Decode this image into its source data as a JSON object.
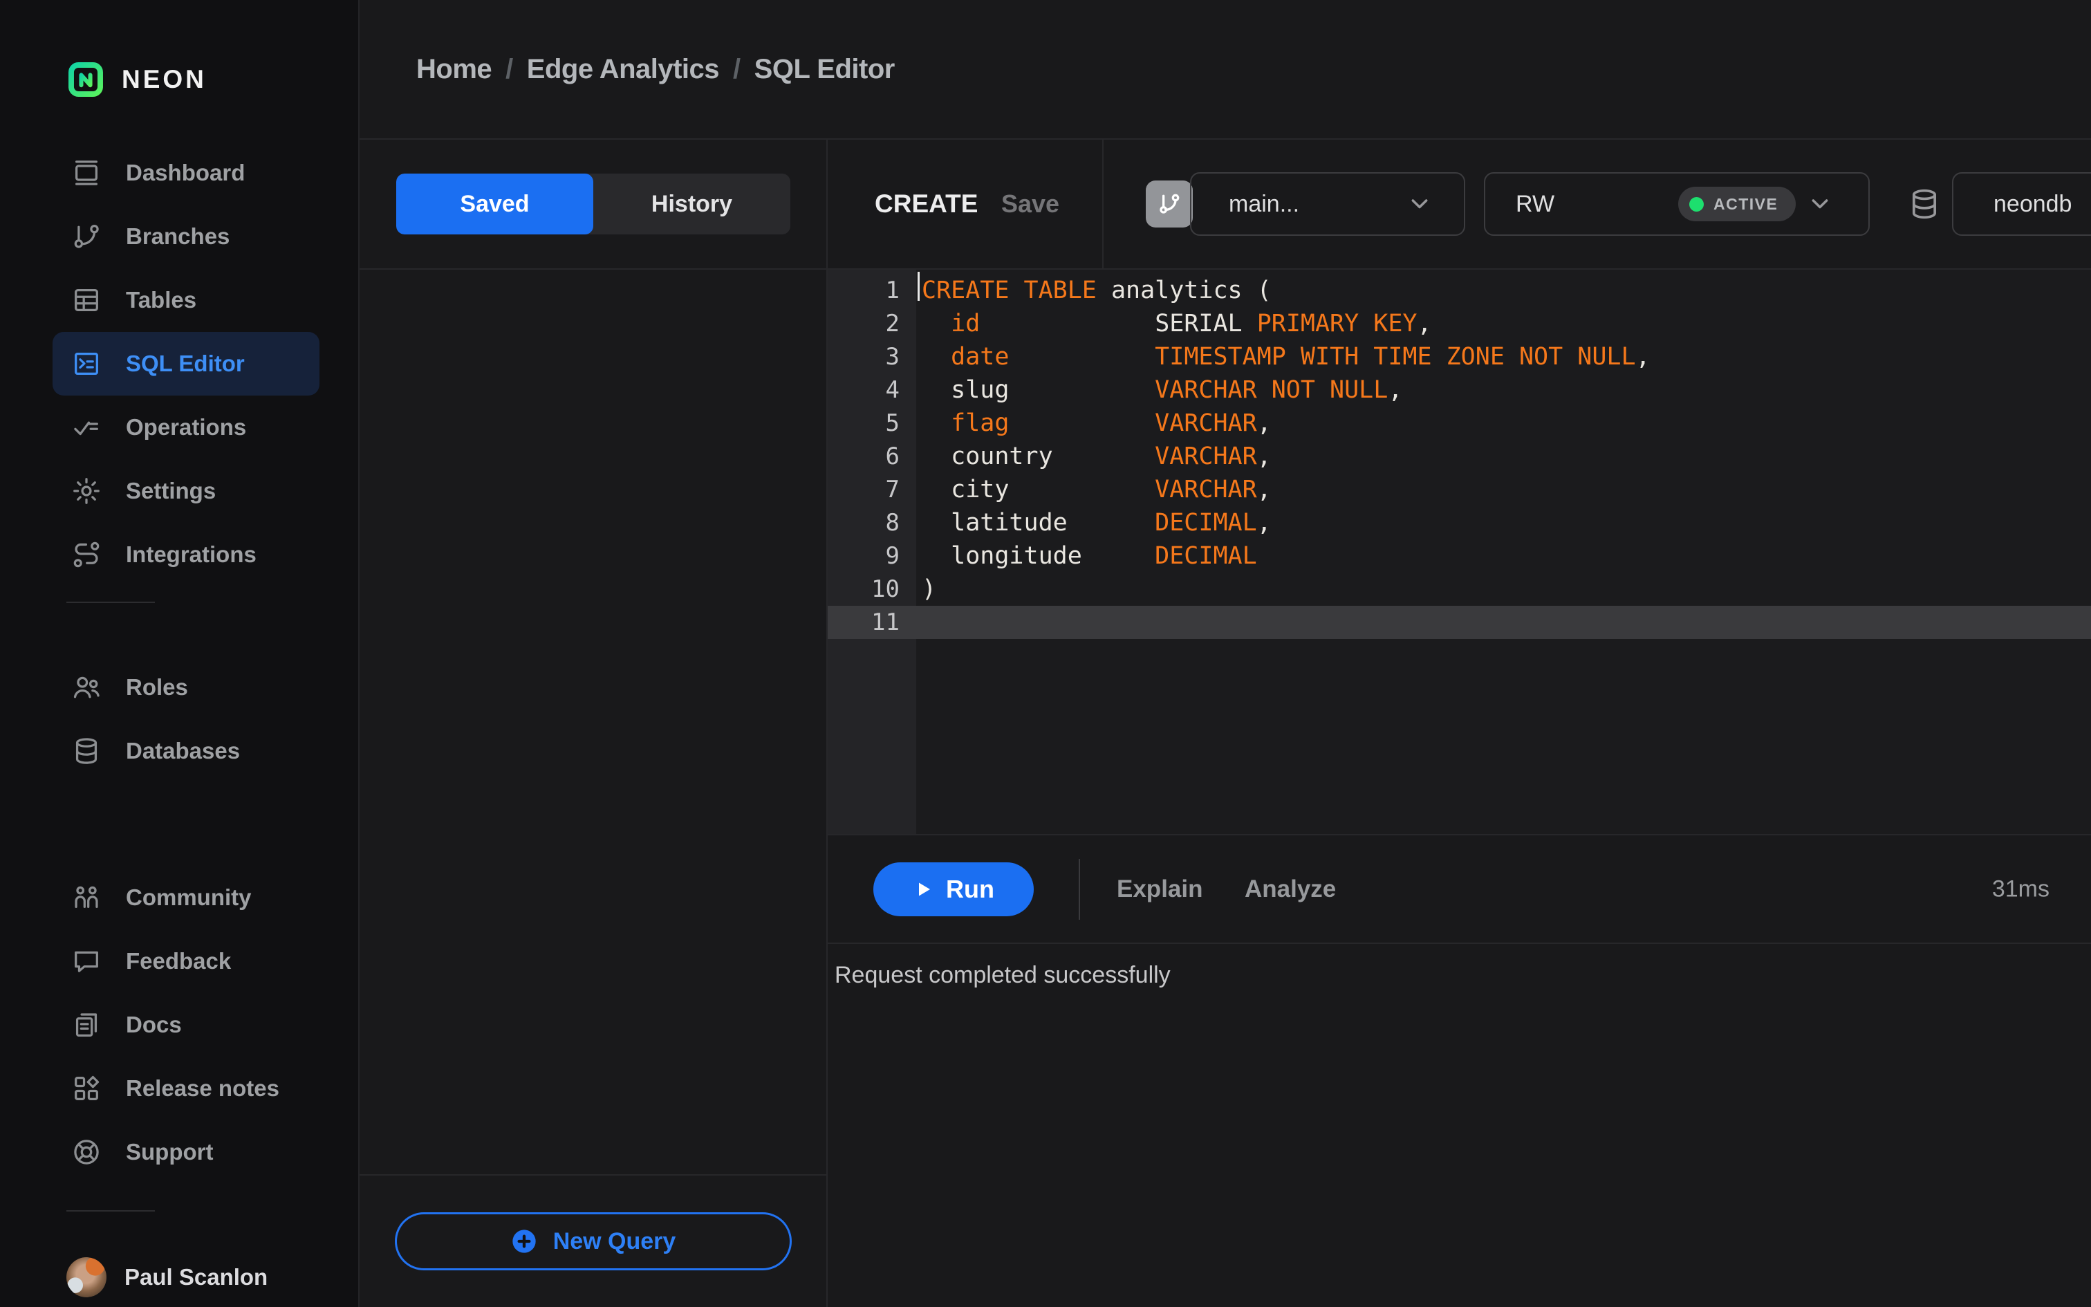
{
  "app": {
    "brand": "NEON"
  },
  "breadcrumb": {
    "separator": "/",
    "items": [
      {
        "label": "Home"
      },
      {
        "label": "Edge Analytics"
      },
      {
        "label": "SQL Editor"
      }
    ]
  },
  "sidebar": {
    "sections": [
      {
        "items": [
          {
            "label": "Dashboard",
            "icon": "dashboard"
          },
          {
            "label": "Branches",
            "icon": "branches"
          },
          {
            "label": "Tables",
            "icon": "tables"
          },
          {
            "label": "SQL Editor",
            "icon": "sql-editor",
            "active": true
          },
          {
            "label": "Operations",
            "icon": "operations"
          },
          {
            "label": "Settings",
            "icon": "settings"
          },
          {
            "label": "Integrations",
            "icon": "integrations"
          }
        ]
      },
      {
        "items": [
          {
            "label": "Roles",
            "icon": "roles"
          },
          {
            "label": "Databases",
            "icon": "databases"
          }
        ]
      },
      {
        "items": [
          {
            "label": "Community",
            "icon": "community"
          },
          {
            "label": "Feedback",
            "icon": "feedback"
          },
          {
            "label": "Docs",
            "icon": "docs"
          },
          {
            "label": "Release notes",
            "icon": "release-notes"
          },
          {
            "label": "Support",
            "icon": "support"
          }
        ]
      }
    ],
    "user": {
      "name": "Paul Scanlon"
    }
  },
  "queries_panel": {
    "tabs": {
      "saved": "Saved",
      "history": "History",
      "active": "saved"
    },
    "new_query_label": "New Query"
  },
  "editor": {
    "query_name": "CREATE",
    "save_label": "Save",
    "branch_select": {
      "value": "main..."
    },
    "endpoint_select": {
      "value": "RW",
      "status": "ACTIVE"
    },
    "database_select": {
      "value": "neondb"
    },
    "run_label": "Run",
    "explain_label": "Explain",
    "analyze_label": "Analyze",
    "duration": "31ms",
    "status_message": "Request completed successfully",
    "code": {
      "lines": [
        {
          "num": 1,
          "tokens": [
            {
              "t": "CREATE TABLE",
              "c": "kw"
            },
            {
              "t": " analytics (",
              "c": "pl"
            }
          ]
        },
        {
          "num": 2,
          "tokens": [
            {
              "t": "  ",
              "c": "pl"
            },
            {
              "t": "id",
              "c": "kw"
            },
            {
              "t": "            ",
              "c": "pl"
            },
            {
              "t": "SERIAL ",
              "c": "pl"
            },
            {
              "t": "PRIMARY KEY",
              "c": "kw"
            },
            {
              "t": ",",
              "c": "pl"
            }
          ]
        },
        {
          "num": 3,
          "tokens": [
            {
              "t": "  ",
              "c": "pl"
            },
            {
              "t": "date",
              "c": "kw"
            },
            {
              "t": "          ",
              "c": "pl"
            },
            {
              "t": "TIMESTAMP WITH TIME ZONE NOT NULL",
              "c": "kw"
            },
            {
              "t": ",",
              "c": "pl"
            }
          ]
        },
        {
          "num": 4,
          "tokens": [
            {
              "t": "  slug          ",
              "c": "pl"
            },
            {
              "t": "VARCHAR NOT NULL",
              "c": "kw"
            },
            {
              "t": ",",
              "c": "pl"
            }
          ]
        },
        {
          "num": 5,
          "tokens": [
            {
              "t": "  ",
              "c": "pl"
            },
            {
              "t": "flag",
              "c": "kw"
            },
            {
              "t": "          ",
              "c": "pl"
            },
            {
              "t": "VARCHAR",
              "c": "kw"
            },
            {
              "t": ",",
              "c": "pl"
            }
          ]
        },
        {
          "num": 6,
          "tokens": [
            {
              "t": "  country       ",
              "c": "pl"
            },
            {
              "t": "VARCHAR",
              "c": "kw"
            },
            {
              "t": ",",
              "c": "pl"
            }
          ]
        },
        {
          "num": 7,
          "tokens": [
            {
              "t": "  city          ",
              "c": "pl"
            },
            {
              "t": "VARCHAR",
              "c": "kw"
            },
            {
              "t": ",",
              "c": "pl"
            }
          ]
        },
        {
          "num": 8,
          "tokens": [
            {
              "t": "  latitude      ",
              "c": "pl"
            },
            {
              "t": "DECIMAL",
              "c": "kw"
            },
            {
              "t": ",",
              "c": "pl"
            }
          ]
        },
        {
          "num": 9,
          "tokens": [
            {
              "t": "  longitude     ",
              "c": "pl"
            },
            {
              "t": "DECIMAL",
              "c": "kw"
            }
          ]
        },
        {
          "num": 10,
          "tokens": [
            {
              "t": ")",
              "c": "pl"
            }
          ]
        },
        {
          "num": 11,
          "tokens": [],
          "active": true,
          "cursor": true
        }
      ]
    }
  },
  "colors": {
    "accent_blue": "#1b6ff2",
    "sidebar_selected_text": "#3e8ff6",
    "sidebar_selected_bg": "#16223a",
    "code_keyword_orange": "#f5781b",
    "code_plain": "#e9e6e0",
    "active_status_green": "#1ddf6e",
    "logo_gradient": [
      "#12d4a4",
      "#59f25e"
    ]
  }
}
